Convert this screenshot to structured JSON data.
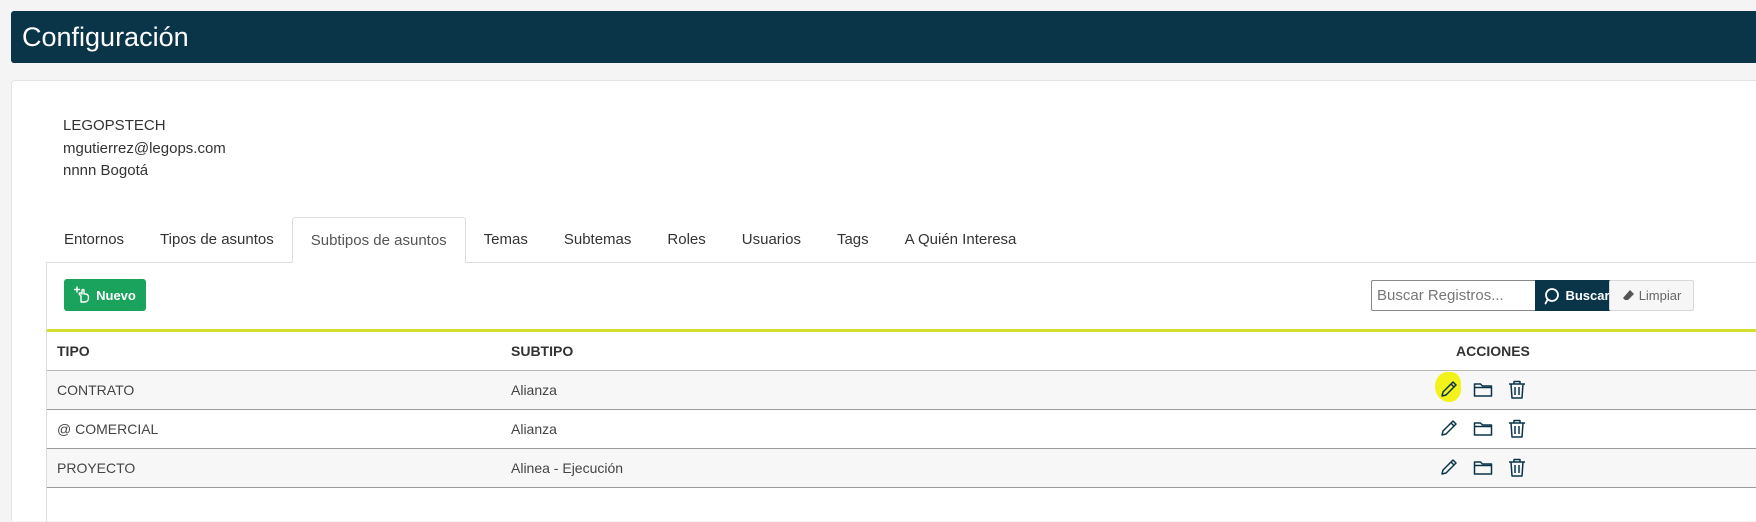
{
  "header": {
    "title": "Configuración"
  },
  "company": {
    "name": "LEGOPSTECH",
    "email": "mgutierrez@legops.com",
    "address": "nnnn Bogotá"
  },
  "tabs": [
    {
      "label": "Entornos",
      "active": false
    },
    {
      "label": "Tipos de asuntos",
      "active": false
    },
    {
      "label": "Subtipos de asuntos",
      "active": true
    },
    {
      "label": "Temas",
      "active": false
    },
    {
      "label": "Subtemas",
      "active": false
    },
    {
      "label": "Roles",
      "active": false
    },
    {
      "label": "Usuarios",
      "active": false
    },
    {
      "label": "Tags",
      "active": false
    },
    {
      "label": "A Quién Interesa",
      "active": false
    }
  ],
  "toolbar": {
    "new_label": "Nuevo",
    "search_placeholder": "Buscar Registros...",
    "search_label": "Buscar",
    "clear_label": "Limpiar"
  },
  "table": {
    "columns": [
      "TIPO",
      "SUBTIPO",
      "ACCIONES"
    ],
    "rows": [
      {
        "tipo": "CONTRATO",
        "subtipo": "Alianza",
        "highlight_edit": true
      },
      {
        "tipo": "@ COMERCIAL",
        "subtipo": "Alianza",
        "highlight_edit": false
      },
      {
        "tipo": "PROYECTO",
        "subtipo": "Alinea - Ejecución",
        "highlight_edit": false
      }
    ]
  },
  "colors": {
    "header_bg": "#0a3549",
    "new_button": "#19a35c",
    "table_accent": "#d4dc2c",
    "highlight": "#f3f31c"
  },
  "icons": {
    "new": "hand-plus-icon",
    "search": "search-icon",
    "clear": "eraser-icon",
    "edit": "pencil-icon",
    "folder": "folder-icon",
    "delete": "trash-icon"
  }
}
